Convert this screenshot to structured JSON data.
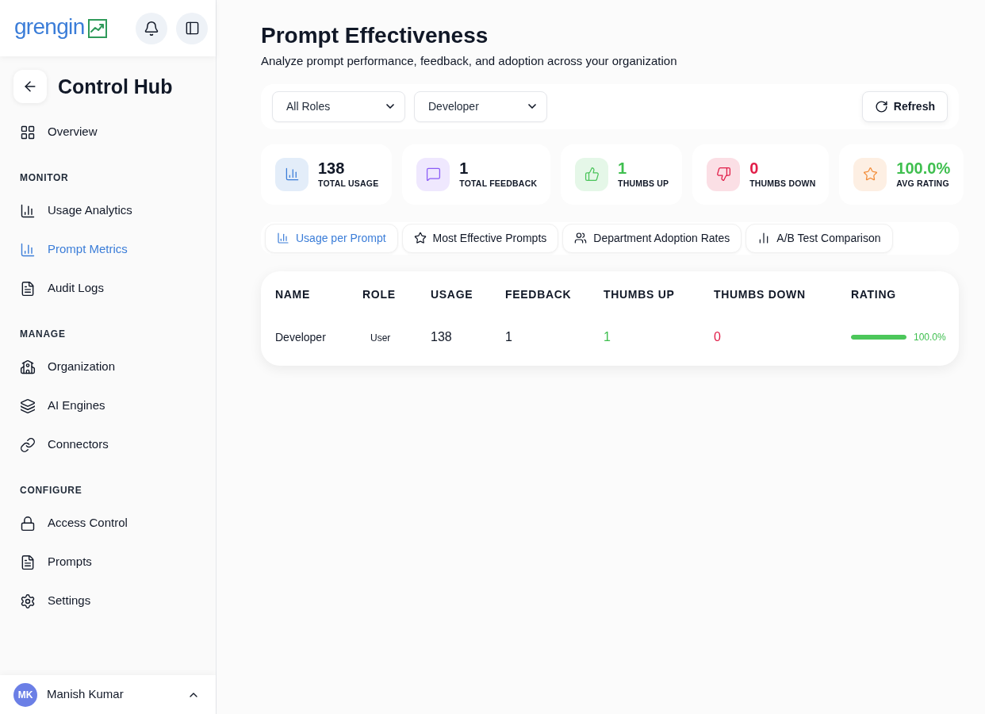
{
  "header": {
    "logo": "grengin"
  },
  "sidebar": {
    "title": "Control Hub",
    "groups": [
      {
        "items": [
          {
            "label": "Overview",
            "selected": false
          }
        ]
      },
      {
        "heading": "MONITOR",
        "items": [
          {
            "label": "Usage Analytics",
            "selected": false
          },
          {
            "label": "Prompt Metrics",
            "selected": true
          },
          {
            "label": "Audit Logs",
            "selected": false
          }
        ]
      },
      {
        "heading": "MANAGE",
        "items": [
          {
            "label": "Organization",
            "selected": false
          },
          {
            "label": "AI Engines",
            "selected": false
          },
          {
            "label": "Connectors",
            "selected": false
          }
        ]
      },
      {
        "heading": "CONFIGURE",
        "items": [
          {
            "label": "Access Control",
            "selected": false
          },
          {
            "label": "Prompts",
            "selected": false
          },
          {
            "label": "Settings",
            "selected": false
          }
        ]
      }
    ]
  },
  "user": {
    "initials": "MK",
    "name": "Manish Kumar"
  },
  "page": {
    "title": "Prompt Effectiveness",
    "subtitle": "Analyze prompt performance, feedback, and adoption across your organization"
  },
  "filters": [
    {
      "value": "All Roles"
    },
    {
      "value": "Developer"
    }
  ],
  "refresh_button": "Refresh",
  "stats": [
    {
      "value": "138",
      "label": "TOTAL USAGE",
      "color": "#3b7dd8",
      "kind": "neutral"
    },
    {
      "value": "1",
      "label": "TOTAL FEEDBACK",
      "color": "#8b5cf6",
      "kind": "neutral"
    },
    {
      "value": "1",
      "label": "THUMBS UP",
      "color": "#4ac45a",
      "kind": "positive"
    },
    {
      "value": "0",
      "label": "THUMBS DOWN",
      "color": "#e11d48",
      "kind": "negative"
    },
    {
      "value": "100.0%",
      "label": "AVG RATING",
      "color": "#f28c38",
      "kind": "positive"
    }
  ],
  "tabs": [
    {
      "label": "Usage per Prompt",
      "selected": true
    },
    {
      "label": "Most Effective Prompts",
      "selected": false
    },
    {
      "label": "Department Adoption Rates",
      "selected": false
    },
    {
      "label": "A/B Test Comparison",
      "selected": false
    }
  ],
  "table": {
    "columns": [
      "NAME",
      "ROLE",
      "USAGE",
      "FEEDBACK",
      "THUMBS UP",
      "THUMBS DOWN",
      "RATING"
    ],
    "rows": [
      {
        "cells": [
          "Developer",
          "User",
          "138",
          "1",
          "1",
          "0"
        ],
        "rating": {
          "level": 1,
          "reading": "100.0%"
        }
      }
    ]
  }
}
